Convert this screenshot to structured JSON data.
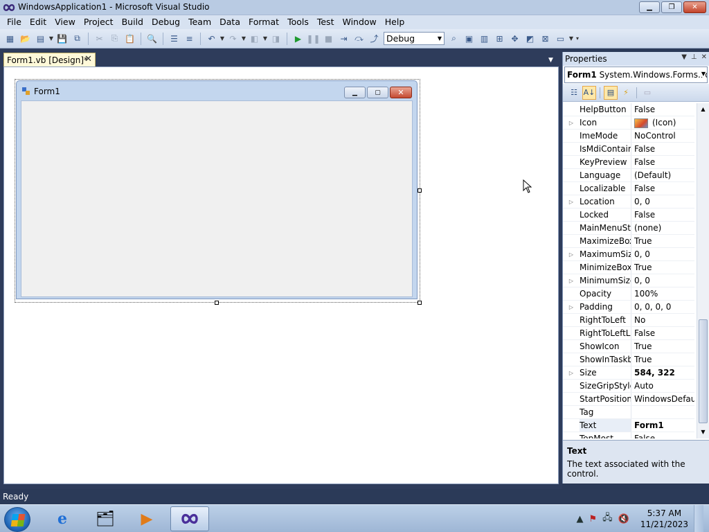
{
  "window": {
    "title": "WindowsApplication1 - Microsoft Visual Studio"
  },
  "menu": [
    "File",
    "Edit",
    "View",
    "Project",
    "Build",
    "Debug",
    "Team",
    "Data",
    "Format",
    "Tools",
    "Test",
    "Window",
    "Help"
  ],
  "toolbar": {
    "configuration": "Debug"
  },
  "document": {
    "tab_label": "Form1.vb [Design]*"
  },
  "form": {
    "title": "Form1"
  },
  "properties": {
    "header": "Properties",
    "object_bold": "Form1",
    "object_type": "System.Windows.Forms.Fo",
    "rows": [
      {
        "name": "HelpButton",
        "value": "False",
        "expandable": false,
        "bold": false
      },
      {
        "name": "Icon",
        "value": "(Icon)",
        "expandable": true,
        "bold": false
      },
      {
        "name": "ImeMode",
        "value": "NoControl",
        "expandable": false,
        "bold": false
      },
      {
        "name": "IsMdiContain",
        "value": "False",
        "expandable": false,
        "bold": false
      },
      {
        "name": "KeyPreview",
        "value": "False",
        "expandable": false,
        "bold": false
      },
      {
        "name": "Language",
        "value": "(Default)",
        "expandable": false,
        "bold": false
      },
      {
        "name": "Localizable",
        "value": "False",
        "expandable": false,
        "bold": false
      },
      {
        "name": "Location",
        "value": "0, 0",
        "expandable": true,
        "bold": false
      },
      {
        "name": "Locked",
        "value": "False",
        "expandable": false,
        "bold": false
      },
      {
        "name": "MainMenuStr",
        "value": "(none)",
        "expandable": false,
        "bold": false
      },
      {
        "name": "MaximizeBox",
        "value": "True",
        "expandable": false,
        "bold": false
      },
      {
        "name": "MaximumSize",
        "value": "0, 0",
        "expandable": true,
        "bold": false
      },
      {
        "name": "MinimizeBox",
        "value": "True",
        "expandable": false,
        "bold": false
      },
      {
        "name": "MinimumSize",
        "value": "0, 0",
        "expandable": true,
        "bold": false
      },
      {
        "name": "Opacity",
        "value": "100%",
        "expandable": false,
        "bold": false
      },
      {
        "name": "Padding",
        "value": "0, 0, 0, 0",
        "expandable": true,
        "bold": false
      },
      {
        "name": "RightToLeft",
        "value": "No",
        "expandable": false,
        "bold": false
      },
      {
        "name": "RightToLeftLa",
        "value": "False",
        "expandable": false,
        "bold": false
      },
      {
        "name": "ShowIcon",
        "value": "True",
        "expandable": false,
        "bold": false
      },
      {
        "name": "ShowInTaskba",
        "value": "True",
        "expandable": false,
        "bold": false
      },
      {
        "name": "Size",
        "value": "584, 322",
        "expandable": true,
        "bold": true
      },
      {
        "name": "SizeGripStyle",
        "value": "Auto",
        "expandable": false,
        "bold": false
      },
      {
        "name": "StartPosition",
        "value": "WindowsDefaul",
        "expandable": false,
        "bold": false
      },
      {
        "name": "Tag",
        "value": "",
        "expandable": false,
        "bold": false
      },
      {
        "name": "Text",
        "value": "Form1",
        "expandable": false,
        "bold": true,
        "selected": true
      },
      {
        "name": "TopMost",
        "value": "False",
        "expandable": false,
        "bold": false
      }
    ],
    "description_title": "Text",
    "description_text": "The text associated with the control."
  },
  "status": {
    "text": "Ready"
  },
  "taskbar": {
    "time": "5:37 AM",
    "date": "11/21/2023"
  },
  "colors": {
    "accent": "#2b3a58",
    "tab": "#fff9d9",
    "form_frame": "#c3d6ee"
  }
}
